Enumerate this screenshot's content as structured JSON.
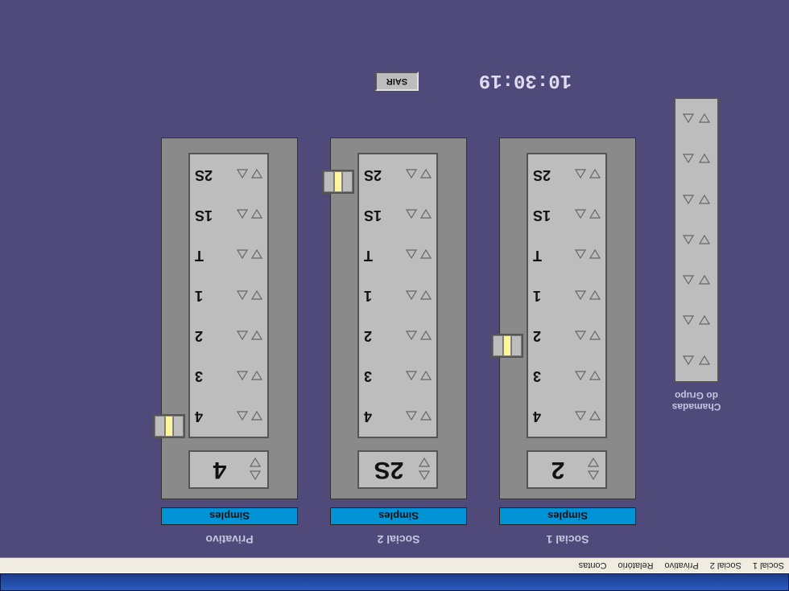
{
  "menubar": {
    "items": [
      "Social 1",
      "Social 2",
      "Privativo",
      "Relatório",
      "Contas"
    ]
  },
  "clock": "10:30:19",
  "sair_label": "SAIR",
  "group_calls": {
    "title_line1": "Chamadas",
    "title_line2": "do Grupo"
  },
  "floors": [
    "4",
    "3",
    "2",
    "1",
    "T",
    "1S",
    "2S"
  ],
  "elevators": [
    {
      "name": "Social 1",
      "mode": "Simples",
      "current_floor": "2",
      "car_floor_index": 2
    },
    {
      "name": "Social 2",
      "mode": "Simples",
      "current_floor": "2S",
      "car_floor_index": 6
    },
    {
      "name": "Privativo",
      "mode": "Simples",
      "current_floor": "4",
      "car_floor_index": 0
    }
  ]
}
